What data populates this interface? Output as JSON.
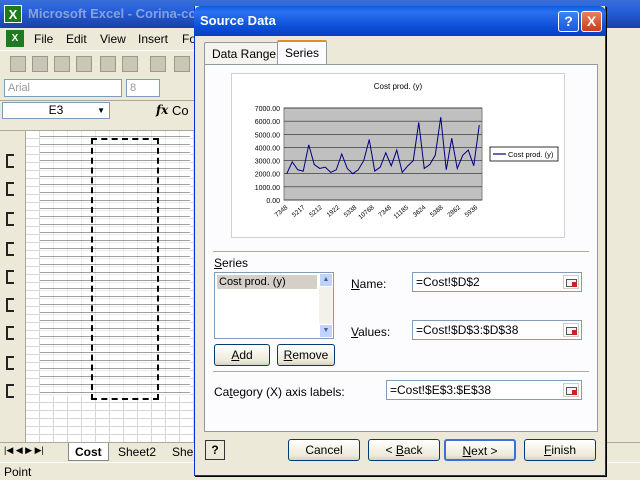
{
  "excel": {
    "title": "Microsoft Excel - Corina-co",
    "menus": [
      "File",
      "Edit",
      "View",
      "Insert",
      "Fo"
    ],
    "font_name": "Arial",
    "font_size": "8",
    "name_box": "E3",
    "fx": "fx",
    "formula": "Co",
    "sheet_tabs": [
      "Cost",
      "Sheet2",
      "She"
    ],
    "status": "Point"
  },
  "dialog": {
    "title": "Source Data",
    "help_button": "?",
    "close_button": "X",
    "tabs": [
      "Data Range",
      "Series"
    ],
    "series_group_label": "Series",
    "series_list": [
      "Cost prod. (y)"
    ],
    "add_label": "Add",
    "remove_label": "Remove",
    "name_label": "Name:",
    "name_value": "=Cost!$D$2",
    "values_label": "Values:",
    "values_value": "=Cost!$D$3:$D$38",
    "category_label": "Category (X) axis labels:",
    "category_value": "=Cost!$E$3:$E$38",
    "footer_help": "?",
    "cancel_label": "Cancel",
    "back_label": "< Back",
    "next_label": "Next >",
    "finish_label": "Finish"
  },
  "chart_data": {
    "type": "line",
    "title": "Cost prod. (y)",
    "xlabel": "",
    "ylabel": "",
    "ylim": [
      0,
      7000
    ],
    "y_ticks": [
      "7000.00",
      "6000.00",
      "5000.00",
      "4000.00",
      "3000.00",
      "2000.00",
      "1000.00",
      "0.00"
    ],
    "x_tick_labels": [
      "7348",
      "5217",
      "5212",
      "1922",
      "5338",
      "10768",
      "7348",
      "11185",
      "3624",
      "5388",
      "2862",
      "5936"
    ],
    "series": [
      {
        "name": "Cost prod. (y)",
        "color": "#000080",
        "values": [
          2000,
          2900,
          2300,
          2200,
          4200,
          2700,
          2400,
          2500,
          2100,
          2300,
          3500,
          2400,
          2000,
          2300,
          3000,
          4600,
          2200,
          2500,
          3600,
          2600,
          3800,
          2100,
          2600,
          3000,
          5900,
          2400,
          2700,
          3400,
          6300,
          2300,
          4700,
          2400,
          3400,
          3800,
          2600,
          5700
        ]
      }
    ],
    "legend": "right",
    "grid": true,
    "plot_background": "#c0c0c0"
  }
}
